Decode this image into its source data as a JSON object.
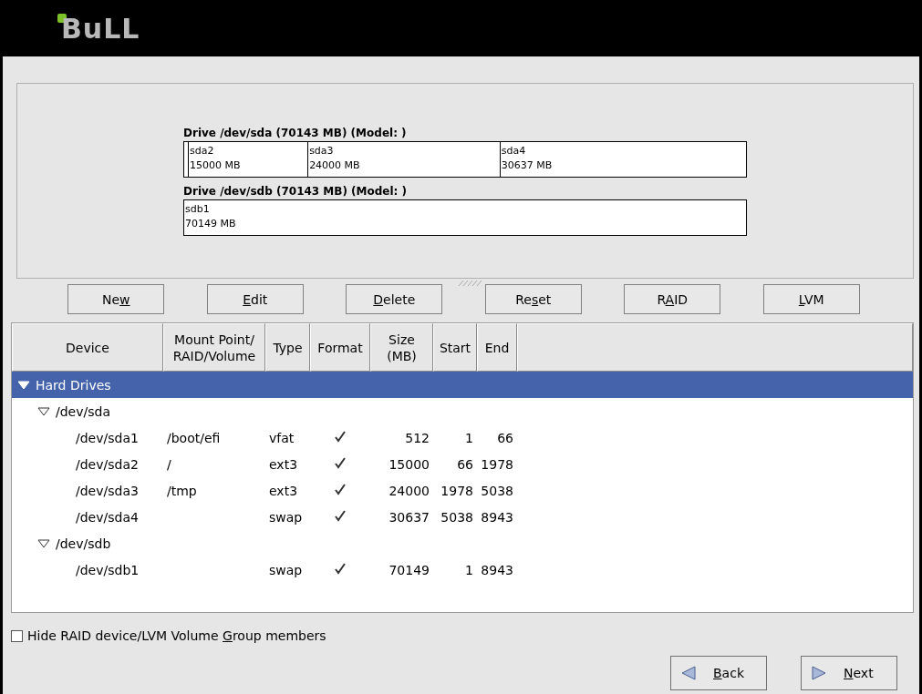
{
  "header": {
    "logo": "BuLL"
  },
  "drives": [
    {
      "title": "Drive /dev/sda (70143 MB) (Model:  )",
      "segments": [
        {
          "level": 0.008
        },
        {
          "name": "sda2",
          "size": "15000 MB",
          "level": 0.213
        },
        {
          "name": "sda3",
          "size": "24000 MB",
          "level": 0.342
        },
        {
          "name": "sda4",
          "size": "30637 MB",
          "level": 0.437
        }
      ]
    },
    {
      "title": "Drive /dev/sdb (70143 MB) (Model:  )",
      "segments": [
        {
          "name": "sdb1",
          "size": "70149 MB",
          "level": 1
        }
      ]
    }
  ],
  "buttons": [
    {
      "parts": [
        {
          "text": "Ne",
          "underlined": false
        },
        {
          "text": "w",
          "underlined": true
        }
      ]
    },
    {
      "parts": [
        {
          "text": "E",
          "underlined": true
        },
        {
          "text": "dit",
          "underlined": false
        }
      ]
    },
    {
      "parts": [
        {
          "text": "D",
          "underlined": true
        },
        {
          "text": "elete",
          "underlined": false
        }
      ]
    },
    {
      "parts": [
        {
          "text": "Re",
          "underlined": false
        },
        {
          "text": "s",
          "underlined": true
        },
        {
          "text": "et",
          "underlined": false
        }
      ]
    },
    {
      "parts": [
        {
          "text": "R",
          "underlined": false
        },
        {
          "text": "A",
          "underlined": true
        },
        {
          "text": "ID",
          "underlined": false
        }
      ]
    },
    {
      "parts": [
        {
          "text": "L",
          "underlined": true
        },
        {
          "text": "VM",
          "underlined": false
        }
      ]
    }
  ],
  "table": {
    "columns": [
      "Device",
      "Mount Point/\nRAID/Volume",
      "Type",
      "Format",
      "Size\n(MB)",
      "Start",
      "End"
    ],
    "rows": [
      {
        "device": "Hard Drives",
        "expanded": true,
        "selected": true,
        "children": [
          {
            "device": "/dev/sda",
            "expanded": true,
            "selected": false,
            "children": [
              {
                "device": "/dev/sda1",
                "mount": "/boot/efi",
                "type": "vfat",
                "format": true,
                "size": "512",
                "start": "1",
                "end": "66",
                "selected": false
              },
              {
                "device": "/dev/sda2",
                "mount": "/",
                "type": "ext3",
                "format": true,
                "size": "15000",
                "start": "66",
                "end": "1978",
                "selected": false
              },
              {
                "device": "/dev/sda3",
                "mount": "/tmp",
                "type": "ext3",
                "format": true,
                "size": "24000",
                "start": "1978",
                "end": "5038",
                "selected": false
              },
              {
                "device": "/dev/sda4",
                "type": "swap",
                "format": true,
                "size": "30637",
                "start": "5038",
                "end": "8943",
                "selected": false
              }
            ]
          },
          {
            "device": "/dev/sdb",
            "expanded": true,
            "selected": false,
            "children": [
              {
                "device": "/dev/sdb1",
                "type": "swap",
                "format": true,
                "size": "70149",
                "start": "1",
                "end": "8943",
                "selected": false
              }
            ]
          }
        ]
      }
    ]
  },
  "hide_members": {
    "checked": false,
    "parts": [
      {
        "text": "Hide RAID device/LVM Volume ",
        "underlined": false
      },
      {
        "text": "G",
        "underlined": true
      },
      {
        "text": "roup members",
        "underlined": false
      }
    ]
  },
  "nav": [
    {
      "kind": "back",
      "parts": [
        {
          "text": "B",
          "underlined": true
        },
        {
          "text": "ack",
          "underlined": false
        }
      ]
    },
    {
      "kind": "next",
      "parts": [
        {
          "text": "N",
          "underlined": true
        },
        {
          "text": "ext",
          "underlined": false
        }
      ]
    }
  ]
}
